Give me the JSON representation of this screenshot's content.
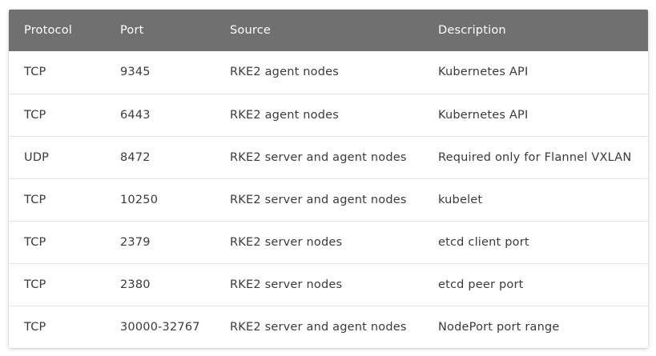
{
  "table": {
    "headers": [
      "Protocol",
      "Port",
      "Source",
      "Description"
    ],
    "rows": [
      [
        "TCP",
        "9345",
        "RKE2 agent nodes",
        "Kubernetes API"
      ],
      [
        "TCP",
        "6443",
        "RKE2 agent nodes",
        "Kubernetes API"
      ],
      [
        "UDP",
        "8472",
        "RKE2 server and agent nodes",
        "Required only for Flannel VXLAN"
      ],
      [
        "TCP",
        "10250",
        "RKE2 server and agent nodes",
        "kubelet"
      ],
      [
        "TCP",
        "2379",
        "RKE2 server nodes",
        "etcd client port"
      ],
      [
        "TCP",
        "2380",
        "RKE2 server nodes",
        "etcd peer port"
      ],
      [
        "TCP",
        "30000-32767",
        "RKE2 server and agent nodes",
        "NodePort port range"
      ]
    ]
  },
  "colors": {
    "header_bg": "#707070",
    "header_text": "#ffffff",
    "cell_text": "#3a3a3a",
    "row_divider": "#e4e4e4"
  }
}
